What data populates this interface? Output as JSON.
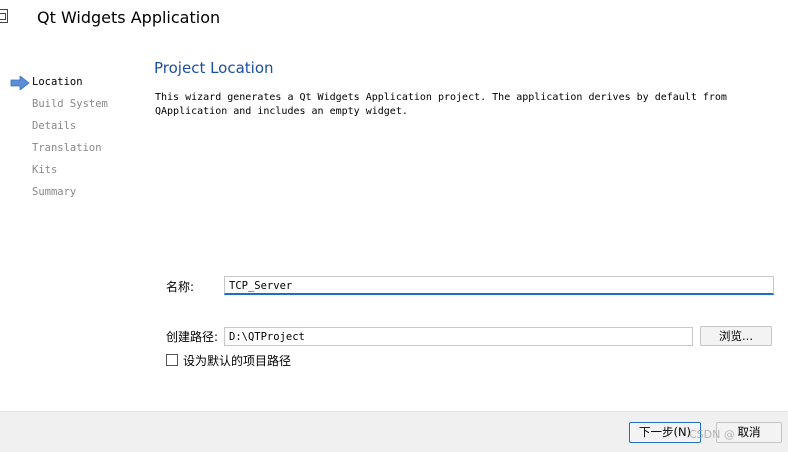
{
  "window": {
    "title": "Qt Widgets Application"
  },
  "sidebar": {
    "steps": [
      {
        "label": "Location",
        "active": true
      },
      {
        "label": "Build System",
        "active": false
      },
      {
        "label": "Details",
        "active": false
      },
      {
        "label": "Translation",
        "active": false
      },
      {
        "label": "Kits",
        "active": false
      },
      {
        "label": "Summary",
        "active": false
      }
    ]
  },
  "page": {
    "title": "Project Location",
    "description_line1": "This wizard generates a Qt Widgets Application project. The application derives by default from",
    "description_line2": "QApplication and includes an empty widget."
  },
  "form": {
    "name_label": "名称:",
    "name_value": "TCP_Server",
    "path_label": "创建路径:",
    "path_value": "D:\\QTProject",
    "browse_label": "浏览...",
    "default_path_label": "设为默认的项目路径",
    "default_path_checked": false
  },
  "footer": {
    "next_label": "下一步(N)",
    "cancel_label": "取消",
    "watermark": "CSDN @      "
  },
  "colors": {
    "accent": "#1f6fbf",
    "title": "#1d4f9e",
    "arrow": "#5b8ed6"
  }
}
